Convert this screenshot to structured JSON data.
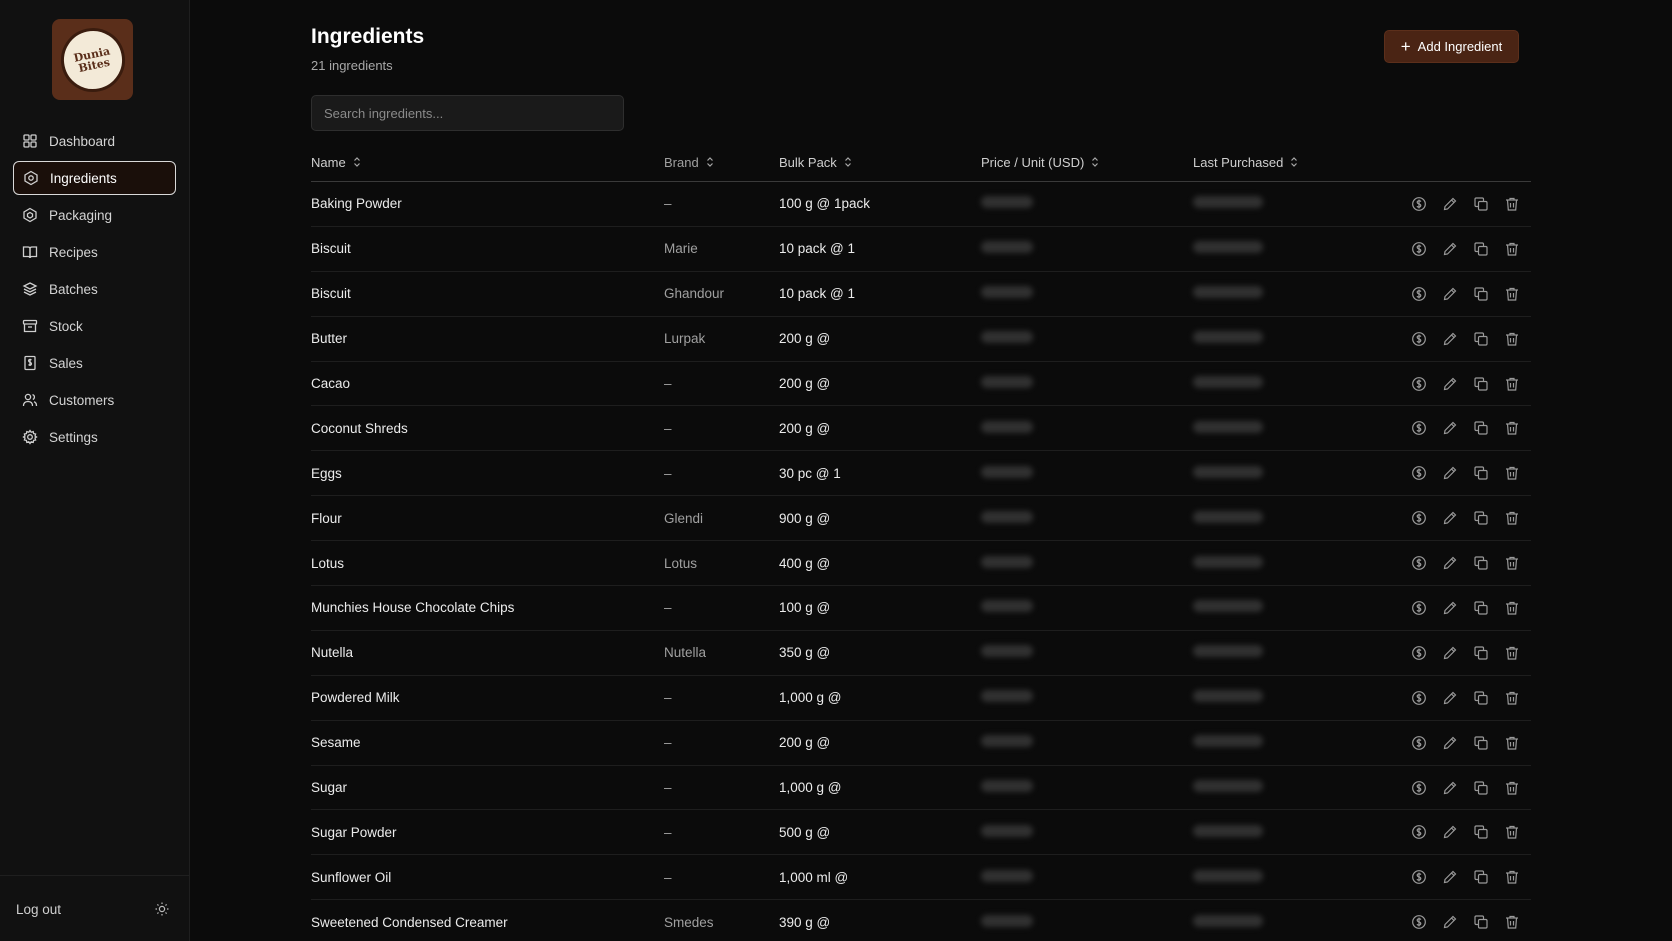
{
  "sidebar": {
    "logo_text": [
      "Dunia",
      "Bites"
    ],
    "items": [
      {
        "label": "Dashboard",
        "icon": "dashboard-icon"
      },
      {
        "label": "Ingredients",
        "icon": "ingredients-icon",
        "active": true
      },
      {
        "label": "Packaging",
        "icon": "packaging-icon"
      },
      {
        "label": "Recipes",
        "icon": "book-icon"
      },
      {
        "label": "Batches",
        "icon": "layers-icon"
      },
      {
        "label": "Stock",
        "icon": "archive-icon"
      },
      {
        "label": "Sales",
        "icon": "receipt-icon"
      },
      {
        "label": "Customers",
        "icon": "users-icon"
      },
      {
        "label": "Settings",
        "icon": "gear-icon"
      }
    ],
    "logout_label": "Log out"
  },
  "header": {
    "title": "Ingredients",
    "subtitle": "21 ingredients",
    "add_button_label": "Add Ingredient"
  },
  "search": {
    "placeholder": "Search ingredients..."
  },
  "table": {
    "columns": [
      "Name",
      "Brand",
      "Bulk Pack",
      "Price / Unit (USD)",
      "Last Purchased"
    ],
    "rows": [
      {
        "name": "Baking Powder",
        "brand": "–",
        "bulk": "100 g @ 1pack"
      },
      {
        "name": "Biscuit",
        "brand": "Marie",
        "bulk": "10 pack @ 1"
      },
      {
        "name": "Biscuit",
        "brand": "Ghandour",
        "bulk": "10 pack @ 1"
      },
      {
        "name": "Butter",
        "brand": "Lurpak",
        "bulk": "200 g @"
      },
      {
        "name": "Cacao",
        "brand": "–",
        "bulk": "200 g @"
      },
      {
        "name": "Coconut Shreds",
        "brand": "–",
        "bulk": "200 g @"
      },
      {
        "name": "Eggs",
        "brand": "–",
        "bulk": "30 pc @ 1"
      },
      {
        "name": "Flour",
        "brand": "Glendi",
        "bulk": "900 g @"
      },
      {
        "name": "Lotus",
        "brand": "Lotus",
        "bulk": "400 g @"
      },
      {
        "name": "Munchies House Chocolate Chips",
        "brand": "–",
        "bulk": "100 g @"
      },
      {
        "name": "Nutella",
        "brand": "Nutella",
        "bulk": "350 g @"
      },
      {
        "name": "Powdered Milk",
        "brand": "–",
        "bulk": "1,000 g @"
      },
      {
        "name": "Sesame",
        "brand": "–",
        "bulk": "200 g @"
      },
      {
        "name": "Sugar",
        "brand": "–",
        "bulk": "1,000 g @"
      },
      {
        "name": "Sugar Powder",
        "brand": "–",
        "bulk": "500 g @"
      },
      {
        "name": "Sunflower Oil",
        "brand": "–",
        "bulk": "1,000 ml @"
      },
      {
        "name": "Sweetened Condensed Creamer",
        "brand": "Smedes",
        "bulk": "390 g @"
      }
    ],
    "row_actions": [
      "dollar-icon",
      "pencil-icon",
      "copy-icon",
      "trash-icon"
    ]
  },
  "colors": {
    "background": "#0b0b0b",
    "sidebar": "#111111",
    "accent": "#4a2414",
    "active_nav_bg": "#1a0f0a"
  }
}
